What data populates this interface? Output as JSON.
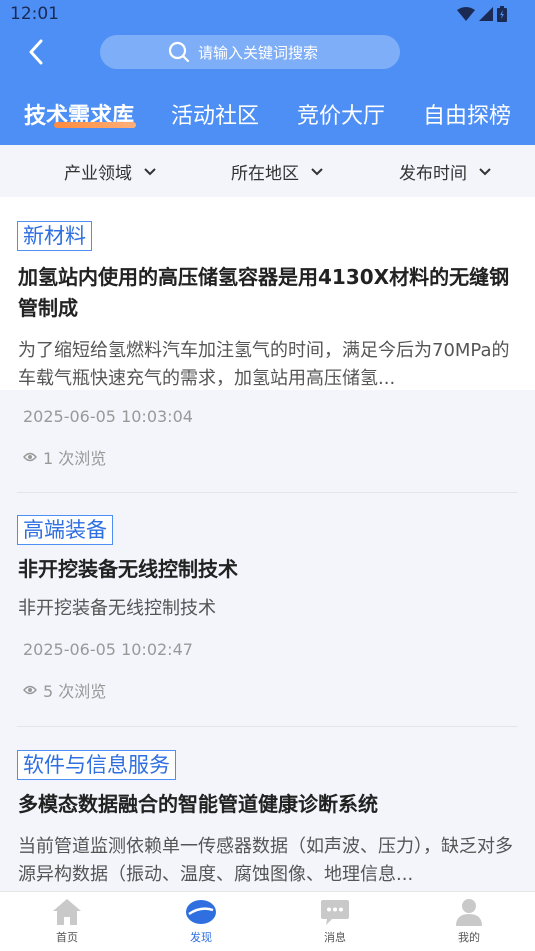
{
  "status_bar": {
    "time": "12:01"
  },
  "search": {
    "placeholder": "请输入关键词搜索"
  },
  "tabs": [
    {
      "label": "技术需求库",
      "active": true
    },
    {
      "label": "活动社区",
      "active": false
    },
    {
      "label": "竞价大厅",
      "active": false
    },
    {
      "label": "自由探榜",
      "active": false
    }
  ],
  "filters": [
    {
      "label": "产业领域"
    },
    {
      "label": "所在地区"
    },
    {
      "label": "发布时间"
    }
  ],
  "items": [
    {
      "tag": "新材料",
      "title": "加氢站内使用的高压储氢容器是用4130X材料的无缝钢管制成",
      "summary": "为了缩短给氢燃料汽车加注氢气的时间，满足今后为70MPa的车载气瓶快速充气的需求，加氢站用高压储氢...",
      "time": "2025-06-05 10:03:04",
      "views": "1 次浏览"
    },
    {
      "tag": "高端装备",
      "title": "非开挖装备无线控制技术",
      "summary": "非开挖装备无线控制技术",
      "time": "2025-06-05 10:02:47",
      "views": "5 次浏览"
    },
    {
      "tag": "软件与信息服务",
      "title": "多模态数据融合的智能管道健康诊断系统",
      "summary": "当前管道监测依赖单一传感器数据（如声波、压力），缺乏对多源异构数据（振动、温度、腐蚀图像、地理信息...",
      "time": "",
      "views": ""
    }
  ],
  "bottom_nav": [
    {
      "label": "首页",
      "icon": "home-icon",
      "active": false
    },
    {
      "label": "发现",
      "icon": "discover-icon",
      "active": true
    },
    {
      "label": "消息",
      "icon": "message-icon",
      "active": false
    },
    {
      "label": "我的",
      "icon": "profile-icon",
      "active": false
    }
  ],
  "colors": {
    "primary": "#4d8ff5",
    "accent": "#ff8a3d",
    "tag_text": "#2f6fe0"
  }
}
